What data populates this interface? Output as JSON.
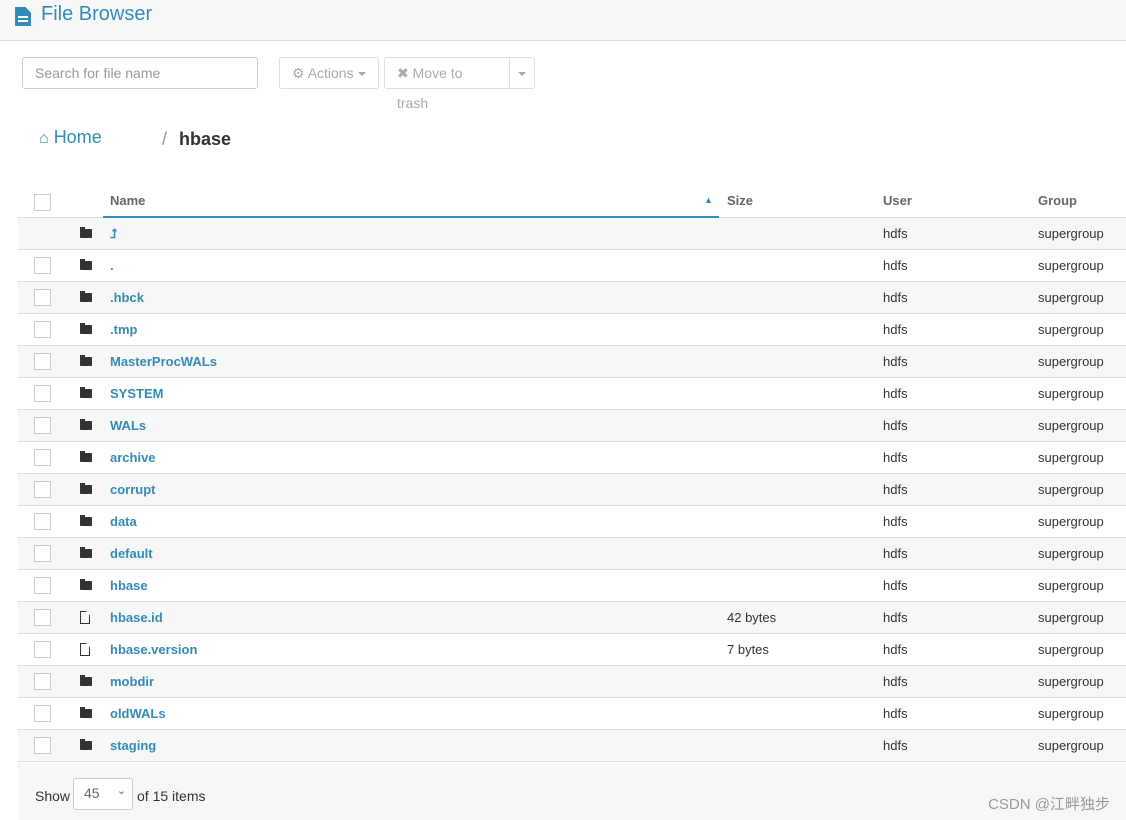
{
  "app": {
    "title": "File Browser"
  },
  "toolbar": {
    "search_placeholder": "Search for file name",
    "actions_label": "Actions",
    "trash_label": "Move to trash"
  },
  "breadcrumb": {
    "home": "Home",
    "separator": "/",
    "current": "hbase"
  },
  "table": {
    "headers": {
      "name": "Name",
      "size": "Size",
      "user": "User",
      "group": "Group"
    },
    "rows": [
      {
        "name": "⮥",
        "type": "folder",
        "size": "",
        "user": "hdfs",
        "group": "supergroup",
        "up": true
      },
      {
        "name": ".",
        "type": "folder",
        "size": "",
        "user": "hdfs",
        "group": "supergroup"
      },
      {
        "name": ".hbck",
        "type": "folder",
        "size": "",
        "user": "hdfs",
        "group": "supergroup"
      },
      {
        "name": ".tmp",
        "type": "folder",
        "size": "",
        "user": "hdfs",
        "group": "supergroup"
      },
      {
        "name": "MasterProcWALs",
        "type": "folder",
        "size": "",
        "user": "hdfs",
        "group": "supergroup"
      },
      {
        "name": "SYSTEM",
        "type": "folder",
        "size": "",
        "user": "hdfs",
        "group": "supergroup"
      },
      {
        "name": "WALs",
        "type": "folder",
        "size": "",
        "user": "hdfs",
        "group": "supergroup"
      },
      {
        "name": "archive",
        "type": "folder",
        "size": "",
        "user": "hdfs",
        "group": "supergroup"
      },
      {
        "name": "corrupt",
        "type": "folder",
        "size": "",
        "user": "hdfs",
        "group": "supergroup"
      },
      {
        "name": "data",
        "type": "folder",
        "size": "",
        "user": "hdfs",
        "group": "supergroup"
      },
      {
        "name": "default",
        "type": "folder",
        "size": "",
        "user": "hdfs",
        "group": "supergroup"
      },
      {
        "name": "hbase",
        "type": "folder",
        "size": "",
        "user": "hdfs",
        "group": "supergroup"
      },
      {
        "name": "hbase.id",
        "type": "file",
        "size": "42 bytes",
        "user": "hdfs",
        "group": "supergroup"
      },
      {
        "name": "hbase.version",
        "type": "file",
        "size": "7 bytes",
        "user": "hdfs",
        "group": "supergroup"
      },
      {
        "name": "mobdir",
        "type": "folder",
        "size": "",
        "user": "hdfs",
        "group": "supergroup"
      },
      {
        "name": "oldWALs",
        "type": "folder",
        "size": "",
        "user": "hdfs",
        "group": "supergroup"
      },
      {
        "name": "staging",
        "type": "folder",
        "size": "",
        "user": "hdfs",
        "group": "supergroup"
      }
    ]
  },
  "footer": {
    "show_label": "Show",
    "page_size": "45",
    "count_label": "of 15 items"
  },
  "watermark": "CSDN @江畔独步",
  "colors": {
    "accent": "#338bb8"
  }
}
